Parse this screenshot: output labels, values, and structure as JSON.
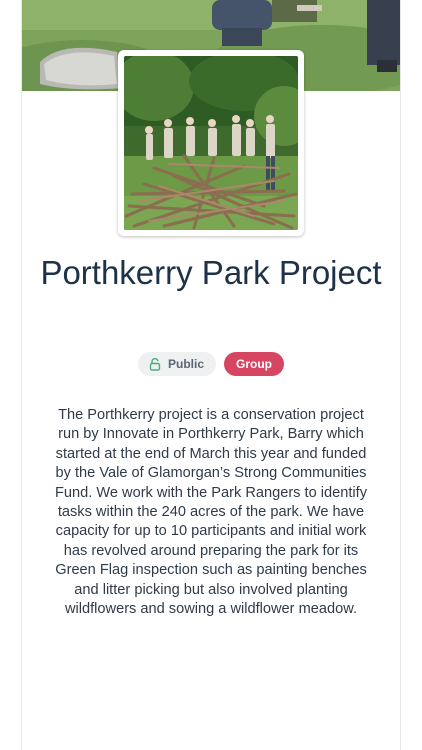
{
  "project": {
    "title": "Porthkerry Park Project",
    "description": "The Porthkerry project is a conservation project run by Innovate in Porthkerry Park, Barry which started at the end of March this year and funded by the Vale of Glamorgan’s Strong Communities Fund. We work with the Park Rangers to identify tasks within the 240 acres of the park. We have capacity for up to 10 participants and initial work has revolved around preparing the park for its Green Flag inspection such as painting benches and litter picking but also involved planting wildflowers and sowing a wildflower meadow.",
    "badges": {
      "visibility": "Public",
      "type": "Group"
    }
  },
  "icons": {
    "visibility": "unlock-icon"
  },
  "colors": {
    "title": "#1d3148",
    "group_badge": "#d64561",
    "public_badge_bg": "#eef0f2",
    "lock_icon": "#4caf7a"
  }
}
